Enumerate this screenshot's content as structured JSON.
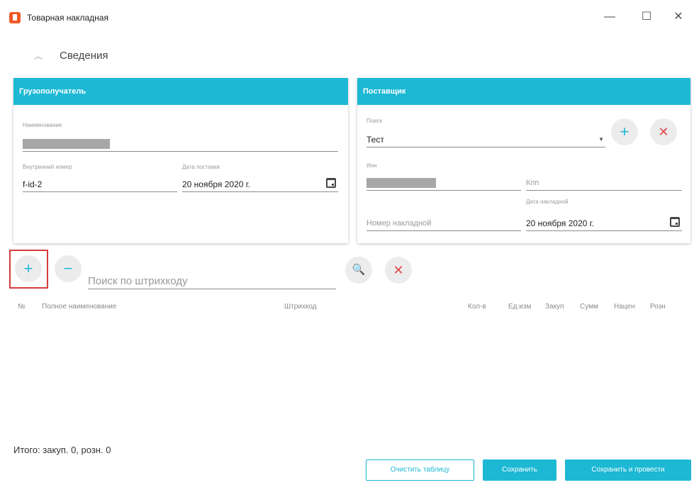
{
  "window": {
    "title": "Товарная накладная",
    "controls": {
      "minimize": "—",
      "maximize": "☐",
      "close": "✕"
    }
  },
  "section": {
    "title": "Сведения",
    "collapse_icon": "chevron-up-icon"
  },
  "consignee": {
    "header": "Грузополучатель",
    "name_label": "Наименование",
    "internal_number_label": "Внутренний номер",
    "internal_number_value": "f-id-2",
    "delivery_date_label": "Дата поставки",
    "delivery_date_value": "20 ноября 2020 г."
  },
  "supplier": {
    "header": "Поставщик",
    "search_label": "Поиск",
    "search_value": "Тест",
    "inn_label": "Инн",
    "kpp_placeholder": "Кпп",
    "invoice_number_placeholder": "Номер накладной",
    "invoice_date_label": "Дата накладной",
    "invoice_date_value": "20 ноября 2020 г."
  },
  "toolbar": {
    "add_symbol": "+",
    "remove_symbol": "−",
    "barcode_placeholder": "Поиск по штрихкоду",
    "search_symbol": "🔍",
    "clear_symbol": "✕"
  },
  "table": {
    "columns": [
      "№",
      "Полное наименование",
      "Штрихкод",
      "Кол-в",
      "Ед.изм",
      "Закуп",
      "Сумм",
      "Нацен",
      "Розн"
    ],
    "rows": []
  },
  "footer": {
    "total": "Итого: закуп. 0, розн. 0",
    "clear_button": "Очистить таблицу",
    "save_button": "Сохранить",
    "save_post_button": "Сохранить и провести"
  },
  "colors": {
    "accent": "#1cb8d4",
    "danger": "#e04848",
    "app_icon": "#ef5a24",
    "highlight": "#d83a3a"
  }
}
